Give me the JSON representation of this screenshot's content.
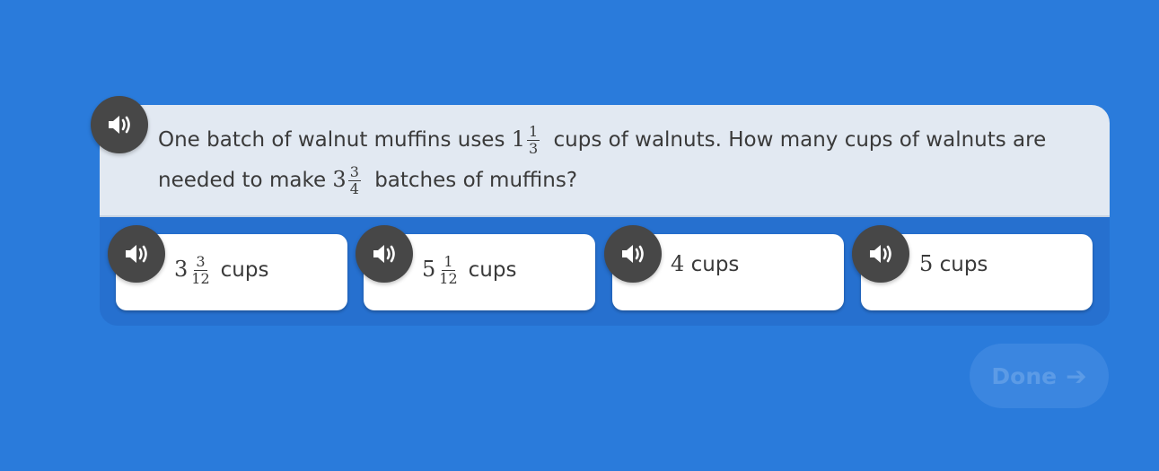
{
  "question": {
    "part1": "One batch of walnut muffins uses",
    "mixed1": {
      "whole": "1",
      "num": "1",
      "den": "3"
    },
    "part2": "cups of walnuts. How many cups of walnuts are needed to make",
    "mixed2": {
      "whole": "3",
      "num": "3",
      "den": "4"
    },
    "part3": "batches of muffins?"
  },
  "answers": [
    {
      "whole": "3",
      "num": "3",
      "den": "12",
      "unit": "cups"
    },
    {
      "whole": "5",
      "num": "1",
      "den": "12",
      "unit": "cups"
    },
    {
      "value": "4",
      "unit": "cups"
    },
    {
      "value": "5",
      "unit": "cups"
    }
  ],
  "done_button": {
    "label": "Done",
    "icon": "arrow-right-icon"
  },
  "icons": {
    "speaker": "speaker-icon"
  },
  "colors": {
    "background": "#2a7bdb",
    "question_bg": "#e2e9f2",
    "speaker_bg": "#474747",
    "done_bg": "#3b86e0"
  }
}
